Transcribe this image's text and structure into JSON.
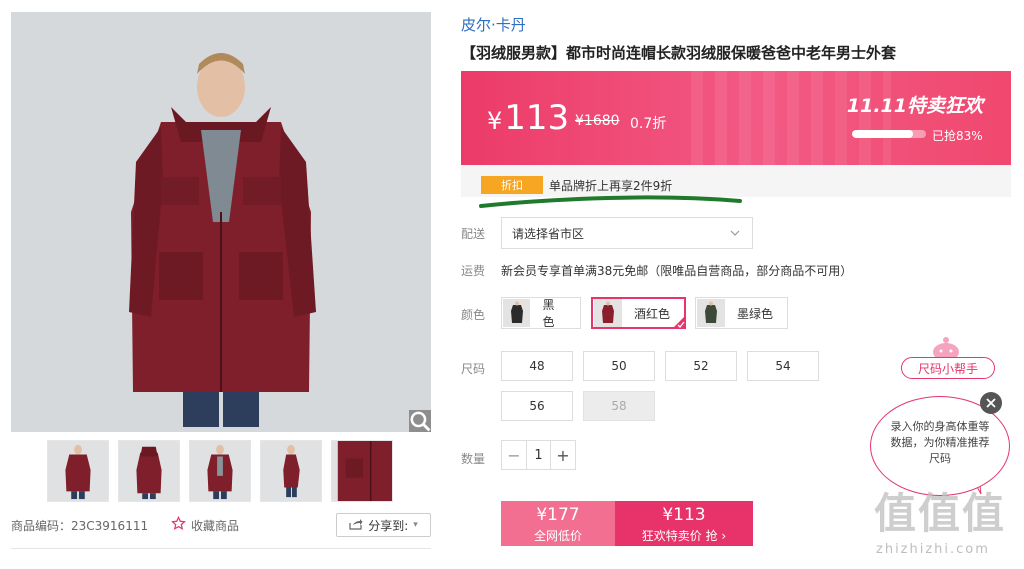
{
  "product": {
    "brand": "皮尔·卡丹",
    "title": "【羽绒服男款】都市时尚连帽长款羽绒服保暖爸爸中老年男士外套",
    "code_label": "商品编码：23C3916111",
    "favorite_label": "收藏商品",
    "share_label": "分享到:"
  },
  "price": {
    "currency": "¥",
    "current": "113",
    "original": "¥1680",
    "discount": "0.7折",
    "sale_name": "11.11特卖狂欢",
    "sold_text": "已抢83%",
    "sold_fraction": 0.83
  },
  "promo": {
    "tag": "折扣",
    "text": "单品牌折上再享2件9折"
  },
  "labels": {
    "delivery": "配送",
    "shipping": "运费",
    "color": "颜色",
    "size": "尺码",
    "quantity": "数量"
  },
  "delivery": {
    "placeholder": "请选择省市区"
  },
  "shipping": {
    "text": "新会员专享首单满38元免邮（限唯品自营商品，部分商品不可用）"
  },
  "colors": [
    {
      "name": "黑色",
      "swatch": "#2b2b2b"
    },
    {
      "name": "酒红色",
      "swatch": "#8a1f2b",
      "selected": true
    },
    {
      "name": "墨绿色",
      "swatch": "#3c4a3a"
    }
  ],
  "sizes": [
    {
      "label": "48"
    },
    {
      "label": "50"
    },
    {
      "label": "52"
    },
    {
      "label": "54"
    },
    {
      "label": "56"
    },
    {
      "label": "58",
      "disabled": true
    }
  ],
  "quantity": {
    "value": "1",
    "minus": "−",
    "plus": "+"
  },
  "buttons": {
    "all_price": "¥177",
    "all_label": "全网低价",
    "sale_price": "¥113",
    "sale_label": "狂欢特卖价 抢 ›"
  },
  "helper": {
    "title": "尺码小帮手",
    "bubble_text": "录入你的身高体重等数据，为你精准推荐尺码"
  },
  "watermark": {
    "logo": "值值值",
    "url": "zhizhizhi.com"
  },
  "colors_theme": {
    "accent": "#e5356a",
    "brand_blue": "#2d6fc0",
    "promo_orange": "#f6a623",
    "coat": "#7e1f2b"
  }
}
